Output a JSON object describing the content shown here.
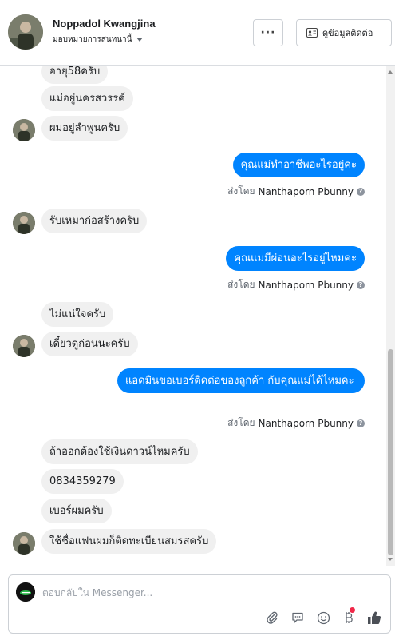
{
  "header": {
    "contact_name": "Noppadol Kwangjina",
    "assign_label": "มอบหมายการสนทนานี้",
    "more_label": "···",
    "info_button_label": "ดูข้อมูลติดต่อ"
  },
  "messages": [
    {
      "dir": "in",
      "text": "อายุ58ครับ"
    },
    {
      "dir": "in",
      "text": "แม่อยู่นครสวรรค์"
    },
    {
      "dir": "in",
      "text": "ผมอยู่ลำพูนครับ"
    },
    {
      "dir": "out",
      "text": "คุณแม่ทำอาชีพอะไรอยู่คะ"
    },
    {
      "dir": "in",
      "text": "รับเหมาก่อสร้างครับ"
    },
    {
      "dir": "out",
      "text": "คุณแม่มีผ่อนอะไรอยู่ไหมคะ"
    },
    {
      "dir": "in",
      "text": "ไม่แน่ใจครับ"
    },
    {
      "dir": "in",
      "text": "เดี๋ยวดูก่อนนะครับ"
    },
    {
      "dir": "out",
      "text": "แอดมินขอเบอร์ติดต่อของลูกค้า กับคุณแม่ได้ไหมคะ"
    },
    {
      "dir": "in",
      "text": "ถ้าออกต้องใช้เงินดาวน์ไหมครับ"
    },
    {
      "dir": "in",
      "text": "0834359279"
    },
    {
      "dir": "in",
      "text": "เบอร์ผมครับ"
    },
    {
      "dir": "in",
      "text": "ใช้ชื่อแฟนผมก็ติดทะเบียนสมรสครับ"
    }
  ],
  "sent_by_prefix": "ส่งโดย",
  "sent_by_name": "Nanthaporn Pbunny",
  "composer": {
    "placeholder": "ตอบกลับใน Messenger..."
  },
  "icons": [
    "paperclip-icon",
    "saved-reply-icon",
    "emoji-icon",
    "payment-icon",
    "like-icon"
  ],
  "colors": {
    "outgoing_bubble": "#0084ff",
    "incoming_bubble": "#f0f0f0",
    "notification_dot": "#f02849"
  }
}
